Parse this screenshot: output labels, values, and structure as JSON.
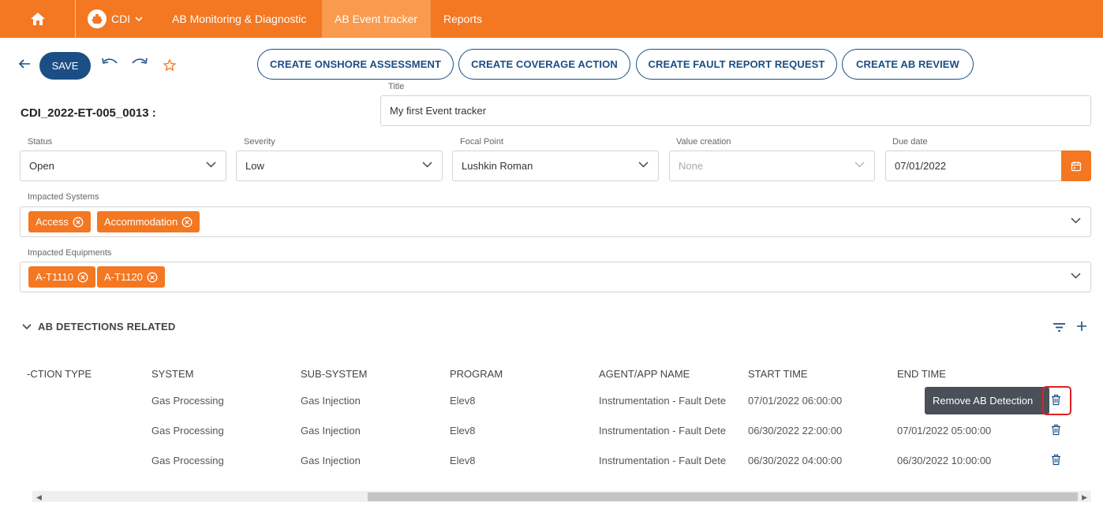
{
  "nav": {
    "site": "CDI",
    "items": [
      "AB Monitoring & Diagnostic",
      "AB Event tracker",
      "Reports"
    ],
    "active_item": "AB Event tracker"
  },
  "toolbar": {
    "save_label": "SAVE",
    "actions": [
      "CREATE ONSHORE ASSESSMENT",
      "CREATE COVERAGE ACTION",
      "CREATE FAULT REPORT REQUEST",
      "CREATE AB REVIEW"
    ]
  },
  "record": {
    "id": "CDI_2022-ET-005_0013 :",
    "title_label": "Title",
    "title_value": "My first Event tracker"
  },
  "fields": {
    "status": {
      "label": "Status",
      "value": "Open"
    },
    "severity": {
      "label": "Severity",
      "value": "Low"
    },
    "focal_point": {
      "label": "Focal Point",
      "value": "Lushkin Roman"
    },
    "value_creation": {
      "label": "Value creation",
      "placeholder": "None"
    },
    "due_date": {
      "label": "Due date",
      "value": "07/01/2022"
    }
  },
  "impacted_systems": {
    "label": "Impacted Systems",
    "chips": [
      "Access",
      "Accommodation"
    ]
  },
  "impacted_equipments": {
    "label": "Impacted Equipments",
    "chips": [
      "A-T1110",
      "A-T1120"
    ]
  },
  "detections": {
    "title": "AB DETECTIONS RELATED",
    "columns": [
      "‐CTION TYPE",
      "SYSTEM",
      "SUB-SYSTEM",
      "PROGRAM",
      "AGENT/APP NAME",
      "START TIME",
      "END TIME"
    ],
    "rows": [
      {
        "system": "Gas Processing",
        "subsystem": "Gas Injection",
        "program": "Elev8",
        "agent": "Instrumentation - Fault Dete",
        "start": "07/01/2022 06:00:00",
        "end": ""
      },
      {
        "system": "Gas Processing",
        "subsystem": "Gas Injection",
        "program": "Elev8",
        "agent": "Instrumentation - Fault Dete",
        "start": "06/30/2022 22:00:00",
        "end": "07/01/2022 05:00:00"
      },
      {
        "system": "Gas Processing",
        "subsystem": "Gas Injection",
        "program": "Elev8",
        "agent": "Instrumentation - Fault Dete",
        "start": "06/30/2022 04:00:00",
        "end": "06/30/2022 10:00:00"
      }
    ],
    "tooltip": "Remove AB Detection"
  },
  "colors": {
    "brand": "#f47721",
    "primary": "#1b4e84"
  }
}
